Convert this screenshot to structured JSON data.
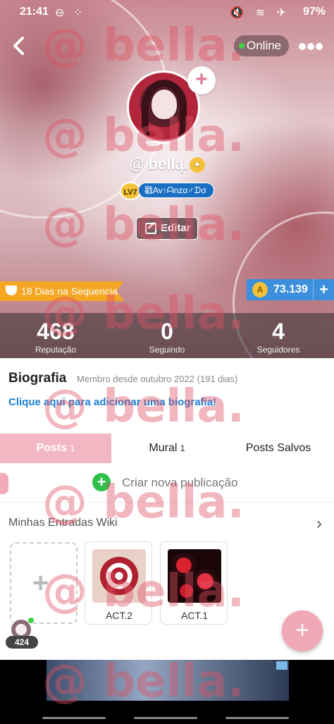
{
  "status_bar": {
    "time": "21:41",
    "left_icons": "⊖ ⁘",
    "right_icons": "🔇 ≋ ✈",
    "battery": "97%"
  },
  "header": {
    "online_label": "Online"
  },
  "profile": {
    "username": "@ bellą.",
    "level": "LV7",
    "title_chip": "戳Av↑ᗩnzα♂ᗪσ",
    "edit_label": "Editar",
    "streak": "18 Dias na Sequencia",
    "coins": "73.139"
  },
  "stats": [
    {
      "value": "468",
      "label": "Reputação"
    },
    {
      "value": "0",
      "label": "Seguindo"
    },
    {
      "value": "4",
      "label": "Seguidores"
    }
  ],
  "bio": {
    "heading": "Biografia",
    "member_since": "Membro desde outubro 2022 (191 dias)",
    "add_link": "Clique aqui para adicionar uma biografia!"
  },
  "tabs": [
    {
      "label": "Posts",
      "count": "1"
    },
    {
      "label": "Mural",
      "count": "1"
    },
    {
      "label": "Posts Salvos",
      "count": ""
    }
  ],
  "create_post": {
    "label": "Criar nova publicação"
  },
  "wiki": {
    "heading": "Minhas Entradas Wiki",
    "cards": [
      {
        "label": "ACT.2"
      },
      {
        "label": "ACT.1"
      }
    ]
  },
  "online_count": "424",
  "watermark": [
    "@ bella.",
    "@ bella.",
    "@ bella.",
    "@ bella.",
    "@ bella.",
    "@ bella.",
    "@ bella.",
    "@ bella.",
    "@ bella.",
    "@ bella."
  ],
  "colors": {
    "accent_pink": "#f3b7c3",
    "coin_blue": "#3c8fdd",
    "streak_orange": "#f5a623",
    "link_blue": "#1b7fd4"
  },
  "icons": [
    "back-arrow-icon",
    "more-icon",
    "plus-icon",
    "verified-icon",
    "pencil-icon",
    "trophy-icon",
    "coin-icon",
    "chevron-right-icon"
  ]
}
